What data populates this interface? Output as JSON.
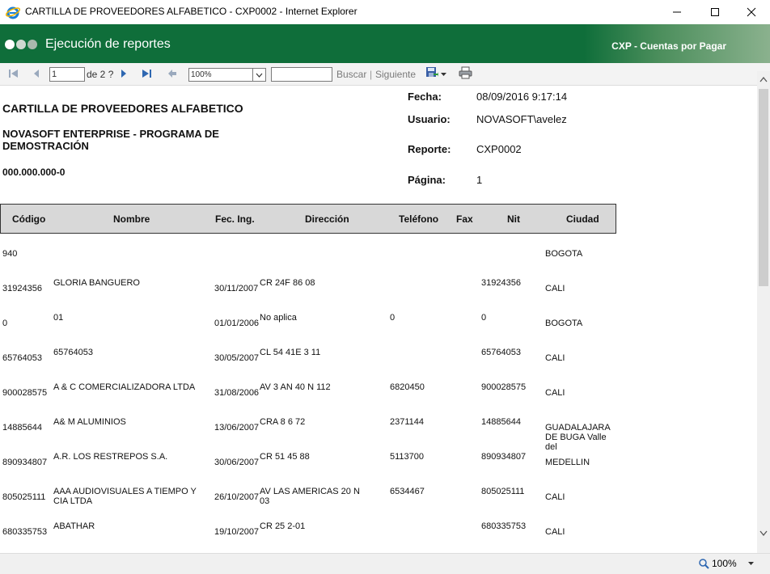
{
  "window": {
    "title": "CARTILLA DE PROVEEDORES ALFABETICO - CXP0002 - Internet Explorer",
    "icon": "ie-icon",
    "controls": [
      "minimize-icon",
      "maximize-icon",
      "close-icon"
    ]
  },
  "banner": {
    "title": "Ejecución de reportes",
    "module": "CXP - Cuentas por Pagar",
    "color": "#0f6e3a"
  },
  "toolbar": {
    "page": "1",
    "page_of": "de 2 ?",
    "zoom": "100%",
    "find_placeholder": "",
    "find_label": "Buscar",
    "separator": "|",
    "next_label": "Siguiente"
  },
  "report": {
    "title": "CARTILLA DE PROVEEDORES ALFABETICO",
    "company": "NOVASOFT ENTERPRISE - PROGRAMA DE DEMOSTRACIÓN",
    "nit": "000.000.000-0",
    "meta": [
      {
        "label": "Fecha:",
        "value": "08/09/2016 9:17:14"
      },
      {
        "label": "Usuario:",
        "value": "NOVASOFT\\avelez"
      },
      {
        "label": "Reporte:",
        "value": "CXP0002"
      },
      {
        "label": "Página:",
        "value": "1"
      }
    ],
    "columns": [
      "Código",
      "Nombre",
      "Fec. Ing.",
      "Dirección",
      "Teléfono",
      "Fax",
      "Nit",
      "Ciudad"
    ],
    "rows": [
      {
        "codigo": "940",
        "nombre": "",
        "fecha": "",
        "direccion": "",
        "telefono": "",
        "fax": "",
        "nit": "",
        "ciudad": "BOGOTA"
      },
      {
        "codigo": "31924356",
        "nombre": "GLORIA BANGUERO",
        "fecha": "30/11/2007",
        "direccion": "CR 24F 86 08",
        "telefono": "",
        "fax": "",
        "nit": "31924356",
        "ciudad": "CALI"
      },
      {
        "codigo": "0",
        "nombre": "01",
        "fecha": "01/01/2006",
        "direccion": "No aplica",
        "telefono": "0",
        "fax": "",
        "nit": "0",
        "ciudad": "BOGOTA"
      },
      {
        "codigo": "65764053",
        "nombre": "65764053",
        "fecha": "30/05/2007",
        "direccion": "CL 54 41E 3 11",
        "telefono": "",
        "fax": "",
        "nit": "65764053",
        "ciudad": "CALI"
      },
      {
        "codigo": "900028575",
        "nombre": "A & C COMERCIALIZADORA LTDA",
        "fecha": "31/08/2006",
        "direccion": "AV 3 AN 40 N 112",
        "telefono": "6820450",
        "fax": "",
        "nit": "900028575",
        "ciudad": "CALI"
      },
      {
        "codigo": "14885644",
        "nombre": "A& M ALUMINIOS",
        "fecha": "13/06/2007",
        "direccion": "CRA  8 6 72",
        "telefono": "2371144",
        "fax": "",
        "nit": "14885644",
        "ciudad": "GUADALAJARA DE BUGA Valle del"
      },
      {
        "codigo": "890934807",
        "nombre": "A.R. LOS RESTREPOS S.A.",
        "fecha": "30/06/2007",
        "direccion": "CR 51 45 88",
        "telefono": "5113700",
        "fax": "",
        "nit": "890934807",
        "ciudad": "MEDELLIN"
      },
      {
        "codigo": "805025111",
        "nombre": "AAA AUDIOVISUALES A TIEMPO Y CIA LTDA",
        "fecha": "26/10/2007",
        "direccion": "AV LAS AMERICAS 20 N 03",
        "telefono": "6534467",
        "fax": "",
        "nit": "805025111",
        "ciudad": "CALI"
      },
      {
        "codigo": "680335753",
        "nombre": "ABATHAR",
        "fecha": "19/10/2007",
        "direccion": "CR 25 2-01",
        "telefono": "",
        "fax": "",
        "nit": "680335753",
        "ciudad": "CALI"
      }
    ]
  },
  "status": {
    "zoom": "100%"
  }
}
